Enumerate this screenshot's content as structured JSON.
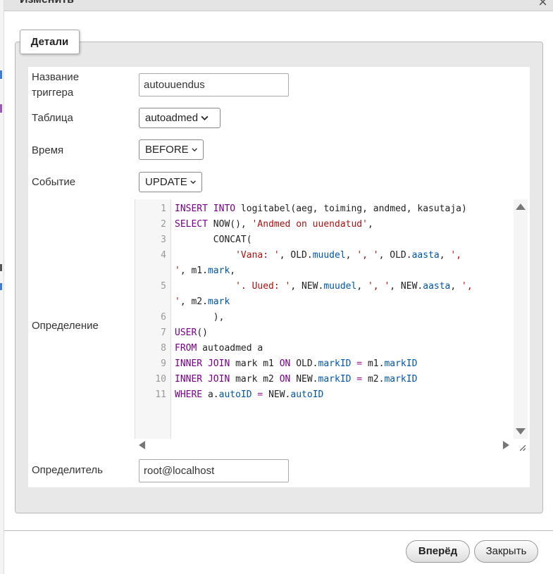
{
  "dialog": {
    "title": "Изменить",
    "close_symbol": "×"
  },
  "section": {
    "legend": "Детали"
  },
  "fields": {
    "trigger_name_label": "Название триггера",
    "trigger_name_value": "autouuendus",
    "table_label": "Таблица",
    "table_value": "autoadmed",
    "time_label": "Время",
    "time_value": "BEFORE",
    "event_label": "Событие",
    "event_value": "UPDATE",
    "definition_label": "Определение",
    "definer_label": "Определитель",
    "definer_value": "root@localhost"
  },
  "editor": {
    "line_numbers": [
      "1",
      "2",
      "3",
      "4",
      "5",
      "6",
      "7",
      "8",
      "9",
      "10",
      "11"
    ],
    "lines": [
      [
        [
          "kw",
          "INSERT INTO "
        ],
        [
          "tx",
          "logitabel(aeg, toiming, andmed, kasutaja)"
        ]
      ],
      [
        [
          "kw",
          "SELECT "
        ],
        [
          "tx",
          "NOW(), "
        ],
        [
          "str",
          "'Andmed on uuendatud'"
        ],
        [
          "tx",
          ","
        ]
      ],
      [
        [
          "tx",
          "       CONCAT("
        ]
      ],
      [
        [
          "str",
          "           'Vana: '"
        ],
        [
          "tx",
          ", OLD."
        ],
        [
          "fld",
          "muudel"
        ],
        [
          "tx",
          ", "
        ],
        [
          "str",
          "', '"
        ],
        [
          "tx",
          ", OLD."
        ],
        [
          "fld",
          "aasta"
        ],
        [
          "tx",
          ", "
        ],
        [
          "str",
          "',"
        ]
      ],
      [
        [
          "str",
          "'"
        ],
        [
          "tx",
          ", m1."
        ],
        [
          "fld",
          "mark"
        ],
        [
          "tx",
          ","
        ]
      ],
      [
        [
          "str",
          "           '. Uued: '"
        ],
        [
          "tx",
          ", NEW."
        ],
        [
          "fld",
          "muudel"
        ],
        [
          "tx",
          ", "
        ],
        [
          "str",
          "', '"
        ],
        [
          "tx",
          ", NEW."
        ],
        [
          "fld",
          "aasta"
        ],
        [
          "tx",
          ", "
        ],
        [
          "str",
          "',"
        ]
      ],
      [
        [
          "str",
          "'"
        ],
        [
          "tx",
          ", m2."
        ],
        [
          "fld",
          "mark"
        ]
      ],
      [
        [
          "tx",
          "       ),"
        ]
      ],
      [
        [
          "kw",
          "USER"
        ],
        [
          "tx",
          "()"
        ]
      ],
      [
        [
          "kw",
          "FROM "
        ],
        [
          "tx",
          "autoadmed a"
        ]
      ],
      [
        [
          "kw",
          "INNER JOIN "
        ],
        [
          "tx",
          "mark m1 "
        ],
        [
          "kw",
          "ON "
        ],
        [
          "tx",
          "OLD."
        ],
        [
          "fld",
          "markID"
        ],
        [
          "op",
          " = "
        ],
        [
          "tx",
          "m1."
        ],
        [
          "fld",
          "markID"
        ]
      ],
      [
        [
          "kw",
          "INNER JOIN "
        ],
        [
          "tx",
          "mark m2 "
        ],
        [
          "kw",
          "ON "
        ],
        [
          "tx",
          "NEW."
        ],
        [
          "fld",
          "markID"
        ],
        [
          "op",
          " = "
        ],
        [
          "tx",
          "m2."
        ],
        [
          "fld",
          "markID"
        ]
      ],
      [
        [
          "kw",
          "WHERE "
        ],
        [
          "tx",
          "a."
        ],
        [
          "fld",
          "autoID"
        ],
        [
          "op",
          " = "
        ],
        [
          "tx",
          "NEW."
        ],
        [
          "fld",
          "autoID"
        ]
      ]
    ]
  },
  "buttons": {
    "go": "Вперёд",
    "close": "Закрыть"
  },
  "colors": {
    "keyword": "#770088",
    "string": "#aa1111",
    "field": "#0055aa",
    "operator": "#981a98"
  },
  "icons": {
    "close": "close-icon",
    "dropdown": "chevron-down-icon",
    "scroll_up": "scroll-up-arrow-icon",
    "scroll_down": "scroll-down-arrow-icon",
    "scroll_left": "scroll-left-arrow-icon",
    "scroll_right": "scroll-right-arrow-icon",
    "resize": "resize-handle-icon"
  }
}
